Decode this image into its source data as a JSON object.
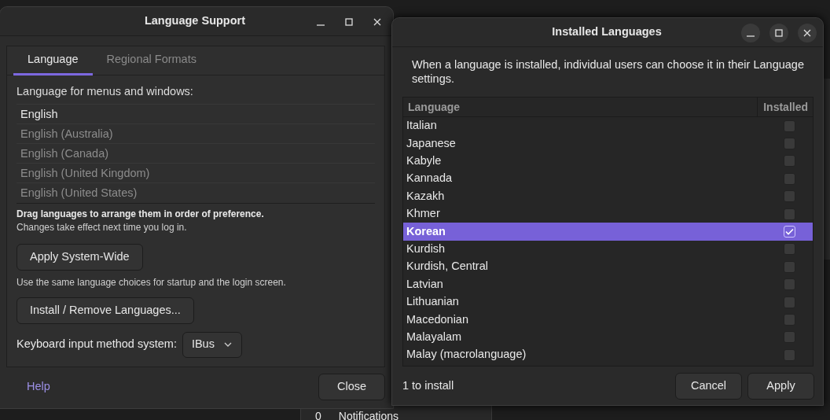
{
  "language_support": {
    "title": "Language Support",
    "tabs": [
      {
        "label": "Language",
        "selected": true
      },
      {
        "label": "Regional Formats",
        "selected": false
      }
    ],
    "list_label": "Language for menus and windows:",
    "languages": [
      {
        "name": "English",
        "dimmed": false
      },
      {
        "name": "English (Australia)",
        "dimmed": true
      },
      {
        "name": "English (Canada)",
        "dimmed": true
      },
      {
        "name": "English (United Kingdom)",
        "dimmed": true
      },
      {
        "name": "English (United States)",
        "dimmed": true
      }
    ],
    "drag_hint": "Drag languages to arrange them in order of preference.",
    "change_note": "Changes take effect next time you log in.",
    "apply_button": "Apply System-Wide",
    "system_note": "Use the same language choices for startup and the login screen.",
    "install_button": "Install / Remove Languages...",
    "input_method": {
      "label": "Keyboard input method system:",
      "value": "IBus"
    },
    "help": "Help",
    "close": "Close"
  },
  "installed_languages": {
    "title": "Installed Languages",
    "description": "When a language is installed, individual users can choose it in their Language settings.",
    "columns": [
      "Language",
      "Installed"
    ],
    "rows": [
      {
        "name": "Italian",
        "installed": false,
        "selected": false
      },
      {
        "name": "Japanese",
        "installed": false,
        "selected": false
      },
      {
        "name": "Kabyle",
        "installed": false,
        "selected": false
      },
      {
        "name": "Kannada",
        "installed": false,
        "selected": false
      },
      {
        "name": "Kazakh",
        "installed": false,
        "selected": false
      },
      {
        "name": "Khmer",
        "installed": false,
        "selected": false
      },
      {
        "name": "Korean",
        "installed": true,
        "selected": true
      },
      {
        "name": "Kurdish",
        "installed": false,
        "selected": false
      },
      {
        "name": "Kurdish, Central",
        "installed": false,
        "selected": false
      },
      {
        "name": "Latvian",
        "installed": false,
        "selected": false
      },
      {
        "name": "Lithuanian",
        "installed": false,
        "selected": false
      },
      {
        "name": "Macedonian",
        "installed": false,
        "selected": false
      },
      {
        "name": "Malayalam",
        "installed": false,
        "selected": false
      },
      {
        "name": "Malay (macrolanguage)",
        "installed": false,
        "selected": false
      }
    ],
    "status": "1 to install",
    "buttons": [
      "Cancel",
      "Apply"
    ]
  },
  "notifications": {
    "count": "0",
    "label": "Notifications"
  }
}
